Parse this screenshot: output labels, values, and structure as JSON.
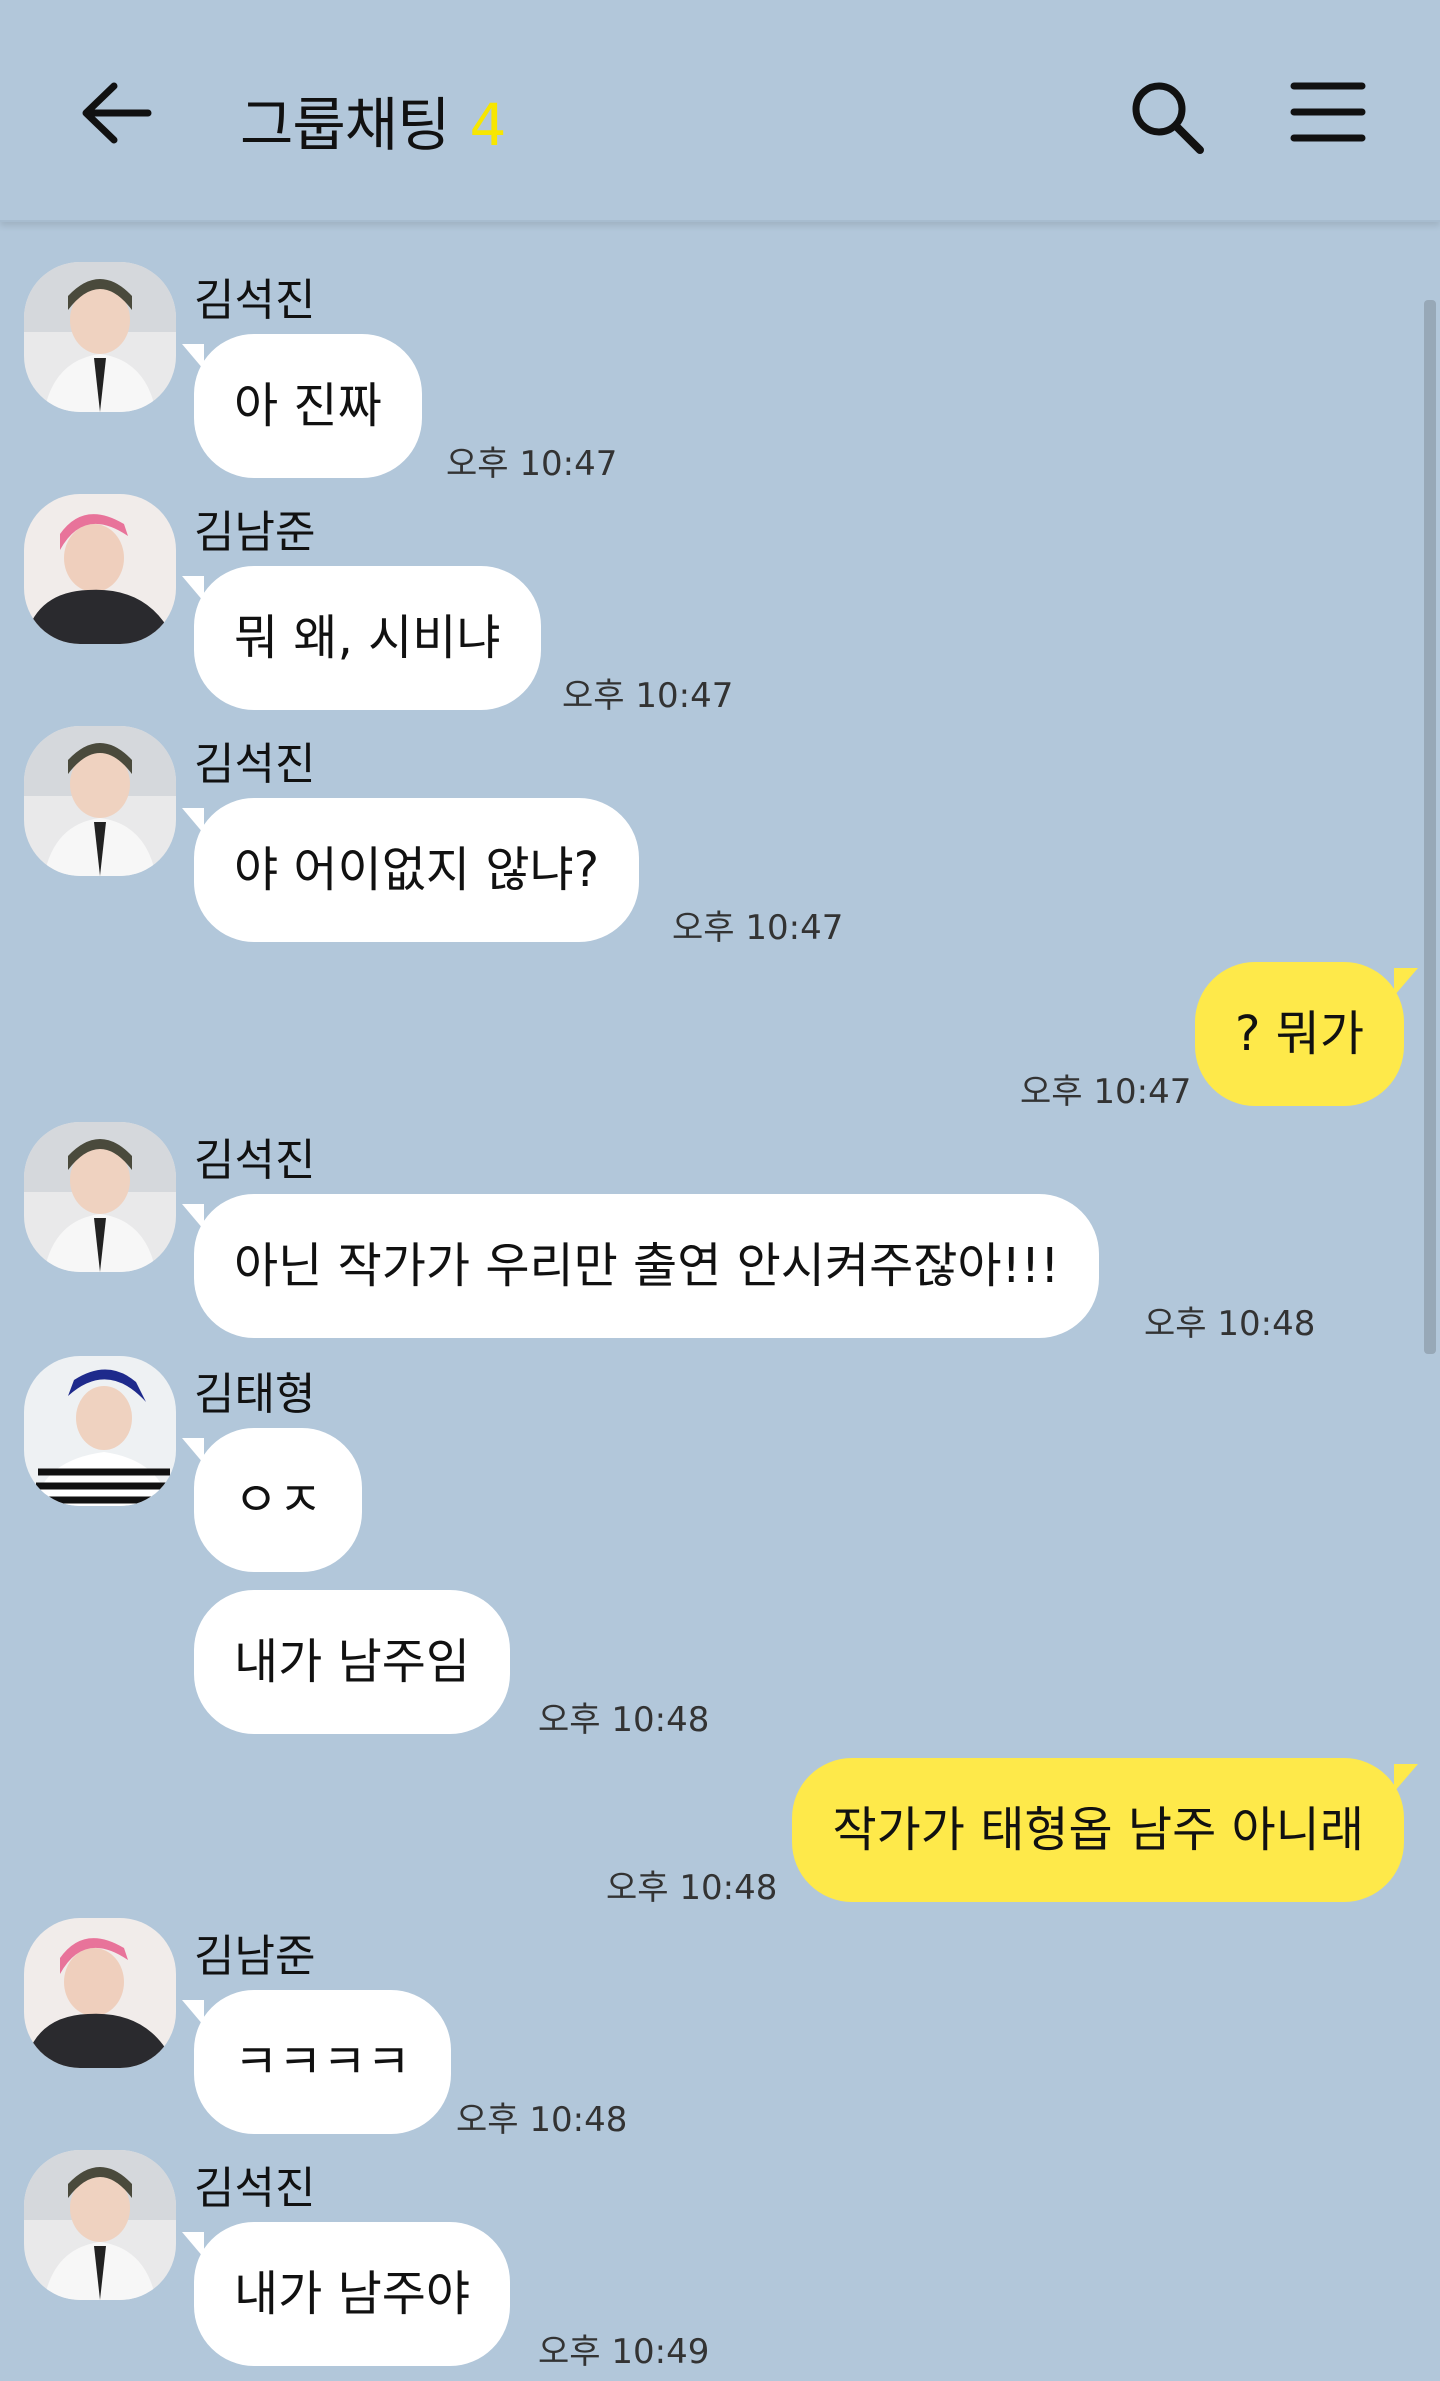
{
  "header": {
    "title": "그룹채팅",
    "member_count": "4",
    "back_icon": "arrow-left-icon",
    "search_icon": "search-icon",
    "menu_icon": "menu-icon"
  },
  "messages": [
    {
      "sender": "김석진",
      "text": "아 진짜",
      "time": "오후 10:47"
    },
    {
      "sender": "김남준",
      "text": "뭐 왜, 시비냐",
      "time": "오후 10:47"
    },
    {
      "sender": "김석진",
      "text": "야 어이없지 않냐?",
      "time": "오후 10:47"
    },
    {
      "sender": "me",
      "text": "? 뭐가",
      "time": "오후 10:47"
    },
    {
      "sender": "김석진",
      "text": "아닌 작가가 우리만 출연 안시켜주잖아!!!",
      "time": "오후 10:48"
    },
    {
      "sender": "김태형",
      "text": "ㅇㅈ",
      "time": ""
    },
    {
      "sender": "김태형",
      "text": "내가 남주임",
      "time": "오후 10:48"
    },
    {
      "sender": "me",
      "text": "작가가 태형옵 남주 아니래",
      "time": "오후 10:48"
    },
    {
      "sender": "김남준",
      "text": "ㅋㅋㅋㅋ",
      "time": "오후 10:48"
    },
    {
      "sender": "김석진",
      "text": "내가 남주야",
      "time": "오후 10:49"
    }
  ],
  "colors": {
    "background": "#b2c7da",
    "my_bubble": "#fee94a",
    "other_bubble": "#ffffff",
    "count": "#f7e600"
  }
}
